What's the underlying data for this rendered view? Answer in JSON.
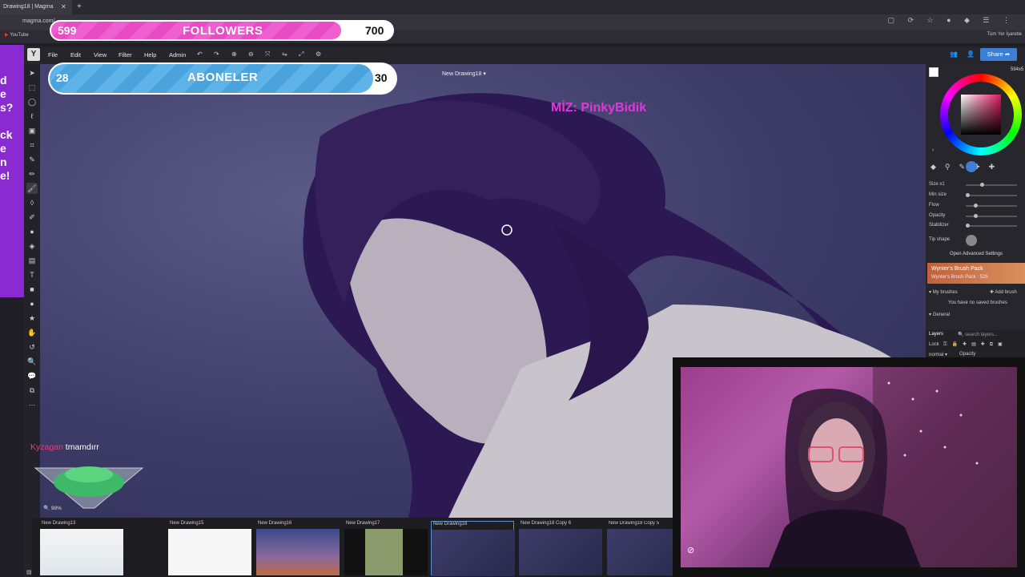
{
  "browser": {
    "tab_title": "Drawing18 | Magma",
    "url": "magma.com/",
    "bookmark": "YouTube",
    "bookmarks_right": "Tüm Yer İşaretle"
  },
  "overlay": {
    "followers": {
      "current": "599",
      "label": "FOLLOWERS",
      "goal": "700",
      "progress": 0.86
    },
    "subscribers": {
      "current": "28",
      "label": "ABONELER",
      "goal": "30",
      "progress": 0.93
    },
    "watermark": "MİZ: PinkyBidik"
  },
  "menu": {
    "items": [
      "File",
      "Edit",
      "View",
      "Filter",
      "Help",
      "Admin"
    ],
    "logo": "Y",
    "share_label": "Share"
  },
  "canvas": {
    "drawing_title": "New Drawing18"
  },
  "right_panel": {
    "resolution": "594x5",
    "size_label": "Size x1",
    "min_size": "Min size",
    "flow": "Flow",
    "opacity": "Opacity",
    "stabilizer": "Stabilizer",
    "tip_shape": "Tip shape",
    "advanced": "Open Advanced Settings",
    "pack_title": "Wynter's Brush Pack",
    "pack_sub": "Wynter's Brush Pack · 525",
    "my_brushes": "My brushes",
    "add_brush": "Add brush",
    "no_saved": "You have no saved brushes",
    "general": "General",
    "layers": "Layers",
    "search_layers": "search layers...",
    "lock": "Lock",
    "blend": "normal",
    "layer_opacity": "Opacity"
  },
  "chat": {
    "user": "Kyzagan",
    "message": "tmamdırr"
  },
  "zoom": "98%",
  "filmstrip": [
    {
      "label": "New Drawing13"
    },
    {
      "label": "New Drawing15"
    },
    {
      "label": "New Drawing16"
    },
    {
      "label": "New Drawing17"
    },
    {
      "label": "New Drawing18"
    },
    {
      "label": "New Drawing18 Copy 6"
    },
    {
      "label": "New Drawing18 Copy 5"
    }
  ],
  "colors": {
    "followers_fill": "#f05fd0",
    "subscribers_fill": "#5fb3e8",
    "watermark": "#e038d8",
    "share": "#3d7fd3",
    "promo": "#8a2bd2"
  }
}
